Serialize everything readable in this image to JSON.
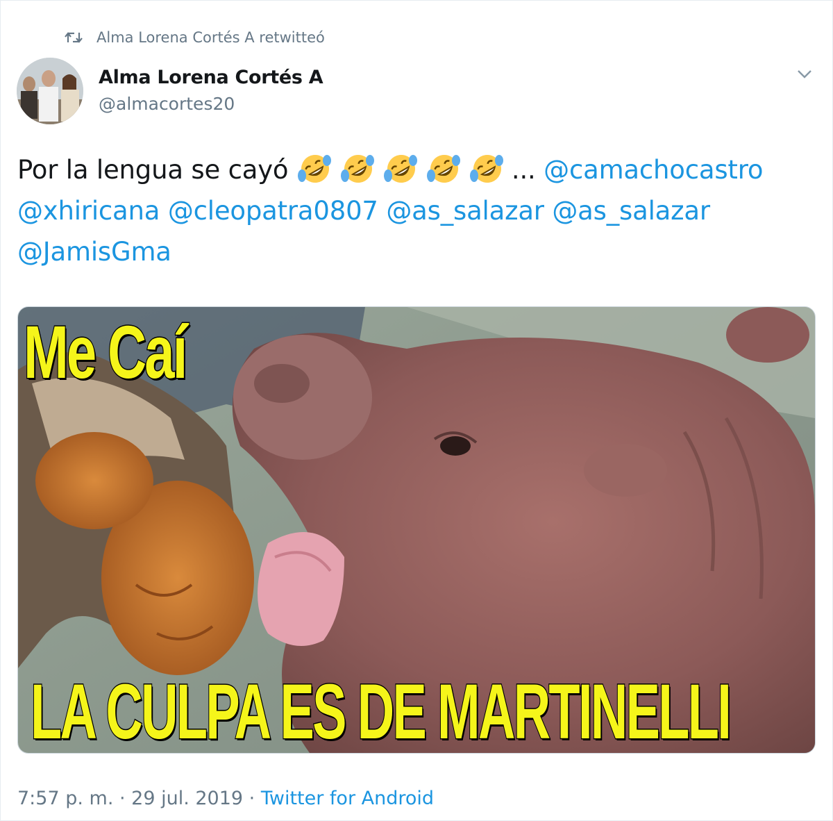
{
  "retweet": {
    "text": "Alma Lorena Cortés A retwitteó",
    "icon": "retweet-icon"
  },
  "author": {
    "name": "Alma Lorena Cortés A",
    "handle": "@almacortes20"
  },
  "tweet": {
    "prefix": "Por la lengua se cayó ",
    "emoji": "🤣",
    "emoji_count": 5,
    "ellipsis": "... ",
    "mentions": [
      "@camachocastro",
      "@xhiricana",
      "@cleopatra0807",
      "@as_salazar",
      "@as_salazar",
      "@JamisGma"
    ]
  },
  "meme": {
    "top_text": "Me Caí",
    "bottom_text": "LA CULPA ES DE MARTINELLI"
  },
  "meta": {
    "time": "7:57 p. m.",
    "separator": " · ",
    "date": "29 jul. 2019",
    "source": "Twitter for Android"
  },
  "colors": {
    "link": "#1b95e0",
    "secondary": "#657786",
    "caption": "#f5f51a"
  }
}
